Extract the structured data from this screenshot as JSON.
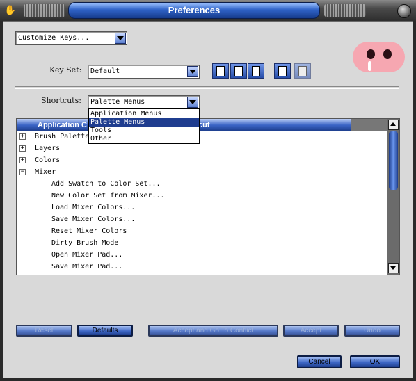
{
  "window": {
    "title": "Preferences"
  },
  "category_select": {
    "value": "Customize Keys..."
  },
  "key_set": {
    "label": "Key Set:",
    "value": "Default"
  },
  "shortcuts": {
    "label": "Shortcuts:",
    "value": "Palette Menus",
    "options": [
      "Application Menus",
      "Palette Menus",
      "Tools",
      "Other"
    ],
    "selected_index": 1
  },
  "list": {
    "header_left": "Application C",
    "header_right": "cut",
    "groups": [
      {
        "label": "Brush Palette",
        "expanded": false
      },
      {
        "label": "Layers",
        "expanded": false
      },
      {
        "label": "Colors",
        "expanded": false
      },
      {
        "label": "Mixer",
        "expanded": true
      }
    ],
    "mixer_items": [
      "Add Swatch to Color Set...",
      "New Color Set from Mixer...",
      "Load Mixer Colors...",
      "Save Mixer Colors...",
      "Reset Mixer Colors",
      "Dirty Brush Mode",
      "Open Mixer Pad...",
      "Save Mixer Pad..."
    ]
  },
  "buttons": {
    "reset": "Reset",
    "defaults": "Defaults",
    "accept_conflict": "Accept and Go To Conflict",
    "accept": "Accept",
    "undo": "Undo",
    "cancel": "Cancel",
    "ok": "OK"
  },
  "icons": {
    "hand": "hand-icon",
    "new": "new-document-icon",
    "open": "open-document-icon",
    "save": "save-document-icon",
    "print": "summary-icon",
    "delete": "delete-icon"
  },
  "colors": {
    "accent": "#2f63c8",
    "panel": "#d9d9d9",
    "selection": "#1f3d8f"
  }
}
